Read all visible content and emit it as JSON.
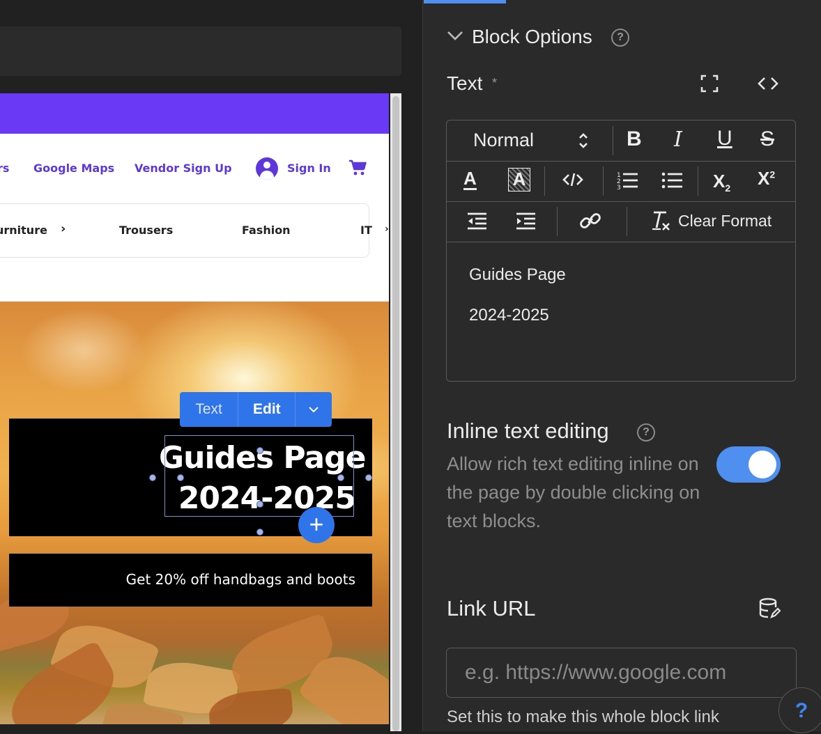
{
  "canvas": {
    "nav": {
      "partial_link": "rs",
      "google_maps": "Google Maps",
      "vendor_signup": "Vendor Sign Up",
      "sign_in": "Sign In"
    },
    "categories": [
      "urniture",
      "Trousers",
      "Fashion",
      "IT"
    ],
    "hero": {
      "title_line1": "Guides Page",
      "title_line2": "2024-2025",
      "subtitle": "Get 20% off handbags and boots"
    },
    "block_toolbar": {
      "type_label": "Text",
      "edit_label": "Edit"
    }
  },
  "panel": {
    "section_title": "Block Options",
    "text_field_label": "Text",
    "required_marker": "*",
    "editor": {
      "paragraph_style": "Normal",
      "clear_format_label": "Clear Format",
      "content_line1": "Guides Page",
      "content_line2": "2024-2025"
    },
    "inline_editing": {
      "label": "Inline text editing",
      "description": "Allow rich text editing inline on the page by double clicking on text blocks.",
      "enabled": true
    },
    "link_url": {
      "label": "Link URL",
      "placeholder": "e.g. https://www.google.com",
      "help": "Set this to make this whole block link"
    },
    "help_button": "?"
  },
  "colors": {
    "accent": "#4f8ff0",
    "brand_purple": "#6a39f6",
    "toolbar_blue": "#2f74e8"
  }
}
